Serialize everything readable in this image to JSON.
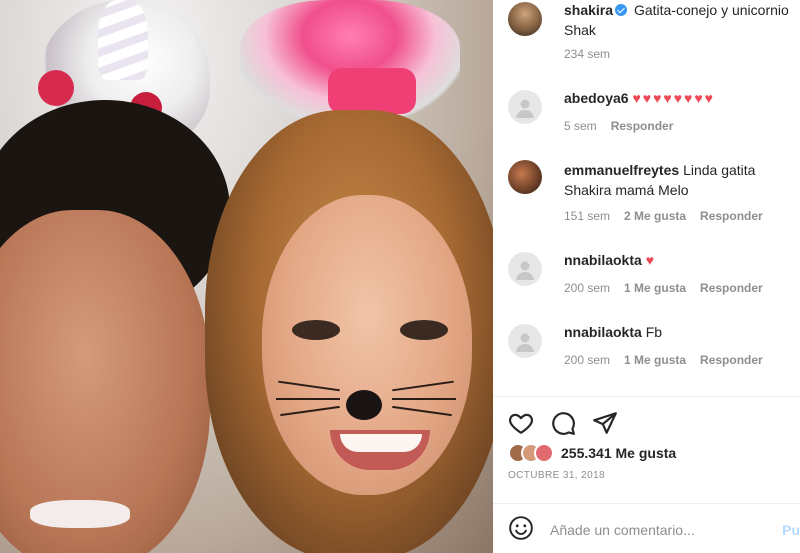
{
  "post": {
    "username": "shakira",
    "caption": "Gatita-conejo y unicornio",
    "caption_line2": "Shak",
    "age": "234 sem"
  },
  "comments": [
    {
      "user": "abedoya6",
      "text": "♥♥♥♥♥♥♥♥",
      "age": "5 sem",
      "likes": "",
      "reply": "Responder"
    },
    {
      "user": "emmanuelfreytes",
      "text": "Linda gatita",
      "text2": "Shakira mamá Melo",
      "age": "151 sem",
      "likes": "2 Me gusta",
      "reply": "Responder"
    },
    {
      "user": "nnabilaokta",
      "text": "♥",
      "age": "200 sem",
      "likes": "1 Me gusta",
      "reply": "Responder"
    },
    {
      "user": "nnabilaokta",
      "text": "Fb",
      "age": "200 sem",
      "likes": "1 Me gusta",
      "reply": "Responder"
    }
  ],
  "actions": {
    "likes_count": "255.341",
    "likes_suffix": "Me gusta",
    "date": "OCTUBRE 31, 2018"
  },
  "add_comment": {
    "placeholder": "Añade un comentario...",
    "post_label": "Pu"
  },
  "colors": {
    "heart": "#ed4956",
    "verified": "#3897f0",
    "muted": "#8e8e8e"
  }
}
